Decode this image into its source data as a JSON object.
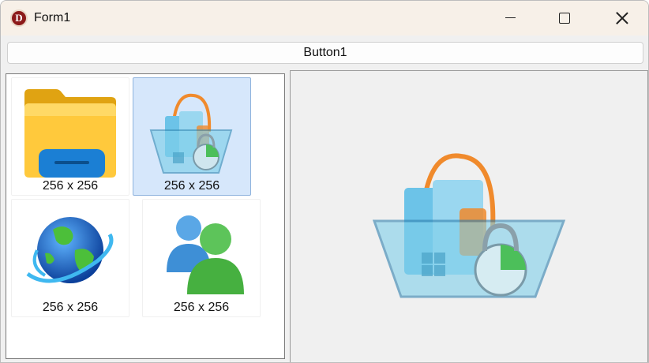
{
  "window": {
    "title": "Form1"
  },
  "caption_buttons": {
    "minimize": "minimize-icon",
    "maximize": "maximize-icon",
    "close": "close-icon"
  },
  "toolbar": {
    "button1_label": "Button1"
  },
  "listview": {
    "items": [
      {
        "icon": "folder-icon",
        "label": "256 x 256",
        "selected": false
      },
      {
        "icon": "basket-icon",
        "label": "256 x 256",
        "selected": true
      },
      {
        "icon": "globe-icon",
        "label": "256 x 256",
        "selected": false
      },
      {
        "icon": "users-icon",
        "label": "256 x 256",
        "selected": false
      }
    ]
  },
  "preview": {
    "icon": "basket-icon"
  },
  "colors": {
    "selection": "#d6e7fb",
    "selection_border": "#8fb3dd",
    "title_bar": "#f7f0e8"
  }
}
